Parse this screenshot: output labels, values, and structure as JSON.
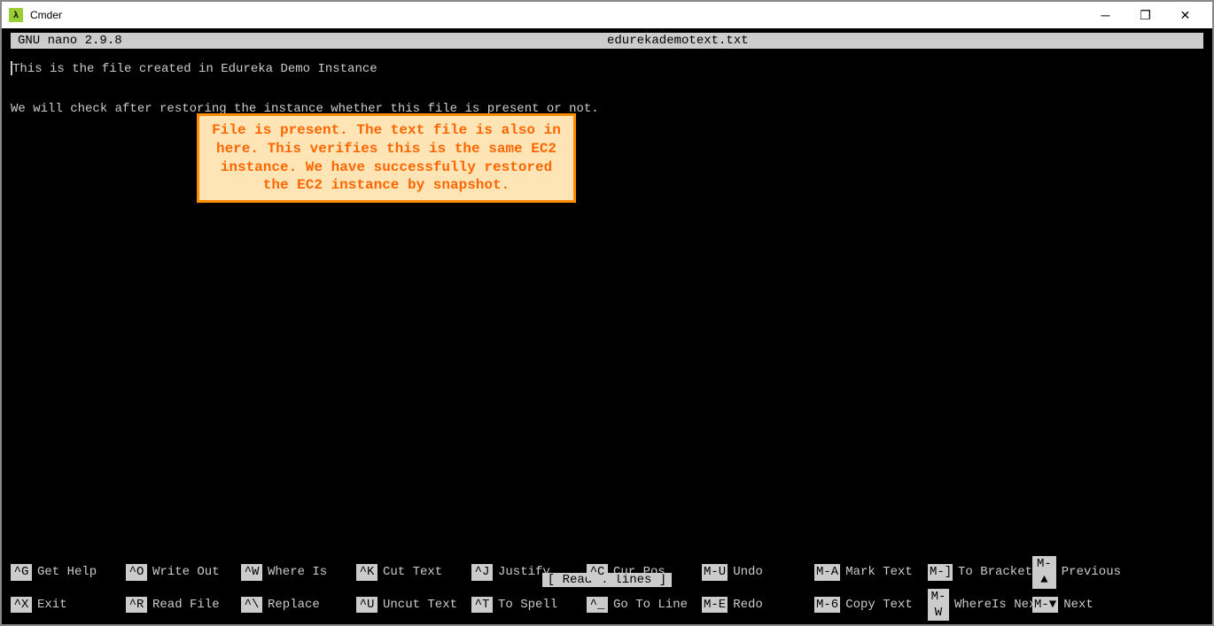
{
  "window": {
    "title": "Cmder",
    "icon_label": "λ"
  },
  "nano": {
    "version": "GNU nano 2.9.8",
    "filename": "edurekademotext.txt"
  },
  "editor": {
    "line1": "This is the file created in Edureka Demo Instance",
    "line2": "",
    "line3": "We will check after restoring the instance whether this file is present or not."
  },
  "annotation": "File is present. The text file is also in here. This verifies this is the same EC2 instance. We have successfully restored the EC2 instance by snapshot.",
  "status": "[ Read 4 lines ]",
  "shortcuts": {
    "row1": [
      {
        "key": "^G",
        "label": "Get Help"
      },
      {
        "key": "^O",
        "label": "Write Out"
      },
      {
        "key": "^W",
        "label": "Where Is"
      },
      {
        "key": "^K",
        "label": "Cut Text"
      },
      {
        "key": "^J",
        "label": "Justify"
      },
      {
        "key": "^C",
        "label": "Cur Pos"
      },
      {
        "key": "M-U",
        "label": "Undo"
      },
      {
        "key": "M-A",
        "label": "Mark Text"
      },
      {
        "key": "M-]",
        "label": "To Bracket"
      },
      {
        "key": "M-▲",
        "label": "Previous"
      }
    ],
    "row2": [
      {
        "key": "^X",
        "label": "Exit"
      },
      {
        "key": "^R",
        "label": "Read File"
      },
      {
        "key": "^\\",
        "label": "Replace"
      },
      {
        "key": "^U",
        "label": "Uncut Text"
      },
      {
        "key": "^T",
        "label": "To Spell"
      },
      {
        "key": "^_",
        "label": "Go To Line"
      },
      {
        "key": "M-E",
        "label": "Redo"
      },
      {
        "key": "M-6",
        "label": "Copy Text"
      },
      {
        "key": "M-W",
        "label": "WhereIs Next"
      },
      {
        "key": "M-▼",
        "label": "Next"
      }
    ]
  }
}
